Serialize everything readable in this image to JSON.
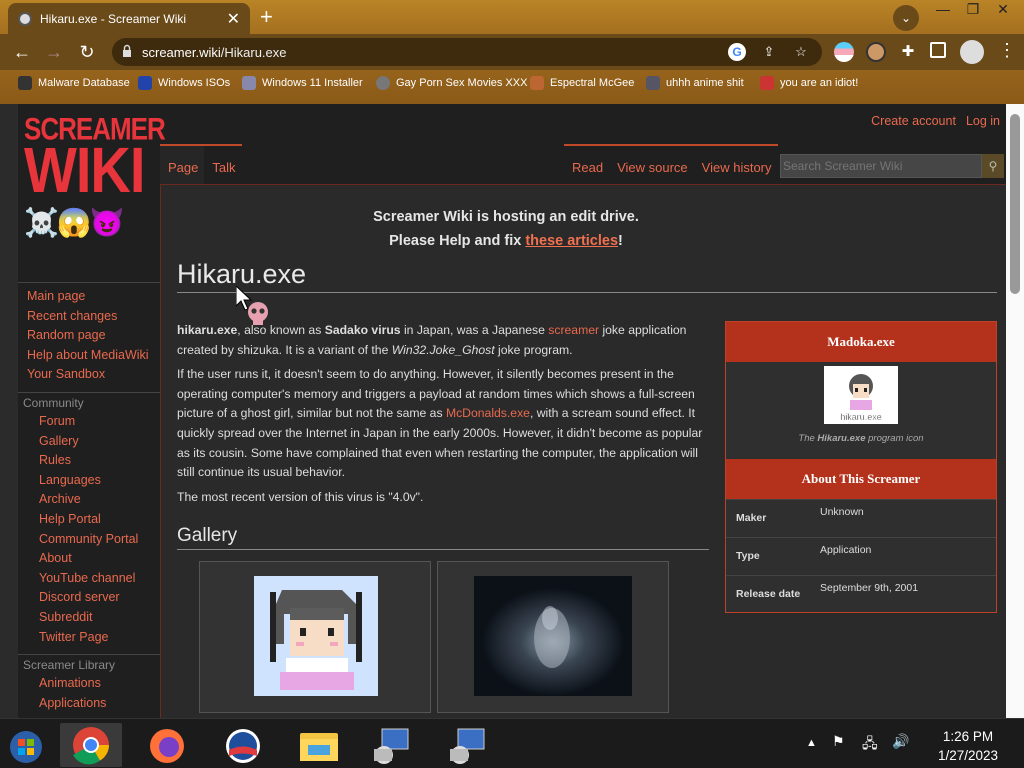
{
  "browser": {
    "tab_title": "Hikaru.exe - Screamer Wiki",
    "url_domain": "screamer.wiki",
    "url_path": "/Hikaru.exe",
    "bookmarks": [
      "Malware Database",
      "Windows ISOs",
      "Windows 11 Installer",
      "Gay Porn Sex Movies XXX",
      "Espectral McGee",
      "uhhh anime shit",
      "you are an idiot!"
    ]
  },
  "site": {
    "logo_line1": "SCREAMER",
    "logo_line2": "WIKI",
    "logo_emoji": "☠️😱😈",
    "personal": {
      "create_account": "Create account",
      "login": "Log in"
    },
    "tabs_left": [
      "Page",
      "Talk"
    ],
    "tabs_right": [
      "Read",
      "View source",
      "View history"
    ],
    "search_placeholder": "Search Screamer Wiki",
    "sidebar_main": [
      "Main page",
      "Recent changes",
      "Random page",
      "Help about MediaWiki",
      "Your Sandbox"
    ],
    "community_heading": "Community",
    "sidebar_community": [
      "Forum",
      "Gallery",
      "Rules",
      "Languages",
      "Archive",
      "Help Portal",
      "Community Portal",
      "About",
      "YouTube channel",
      "Discord server",
      "Subreddit",
      "Twitter Page"
    ],
    "library_heading": "Screamer Library",
    "sidebar_library": [
      "Animations",
      "Applications"
    ]
  },
  "article": {
    "notice_line1": "Screamer Wiki is hosting an edit drive.",
    "notice_line2_pre": "Please Help and fix ",
    "notice_link": "these articles",
    "notice_line2_post": "!",
    "title": "Hikaru.exe",
    "p1_b1": "hikaru.exe",
    "p1_t1": ", also known as ",
    "p1_b2": "Sadako virus",
    "p1_t2": " in Japan, was a Japanese ",
    "p1_link": "screamer",
    "p1_t3": " joke application created by shizuka. It is a variant of the ",
    "p1_i": "Win32.Joke_Ghost",
    "p1_t4": " joke program.",
    "p2_t1": "If the user runs it, it doesn't seem to do anything. However, it silently becomes present in the operating computer's memory and triggers a payload at random times which shows a full-screen picture of a ghost girl, similar but not the same as ",
    "p2_link": "McDonalds.exe",
    "p2_t2": ", with a scream sound effect. It quickly spread over the Internet in Japan in the early 2000s. However, it didn't become as popular as its cousin. Some have complained that even when restarting the computer, the application will still continue its usual behavior.",
    "p3": "The most recent version of this virus is \"4.0v\".",
    "gallery_heading": "Gallery"
  },
  "infobox": {
    "title": "Madoka.exe",
    "image_label": "hikaru.exe",
    "caption_pre": "The ",
    "caption_b": "Hikaru.exe",
    "caption_post": " program icon",
    "subheading": "About This Screamer",
    "rows": [
      {
        "k": "Maker",
        "v": "Unknown"
      },
      {
        "k": "Type",
        "v": "Application"
      },
      {
        "k": "Release date",
        "v": "September 9th, 2001"
      }
    ]
  },
  "taskbar": {
    "time": "1:26 PM",
    "date": "1/27/2023"
  },
  "colors": {
    "accent": "#e9694e",
    "header_red": "#b4321c",
    "chrome": "#6b4a1a"
  }
}
